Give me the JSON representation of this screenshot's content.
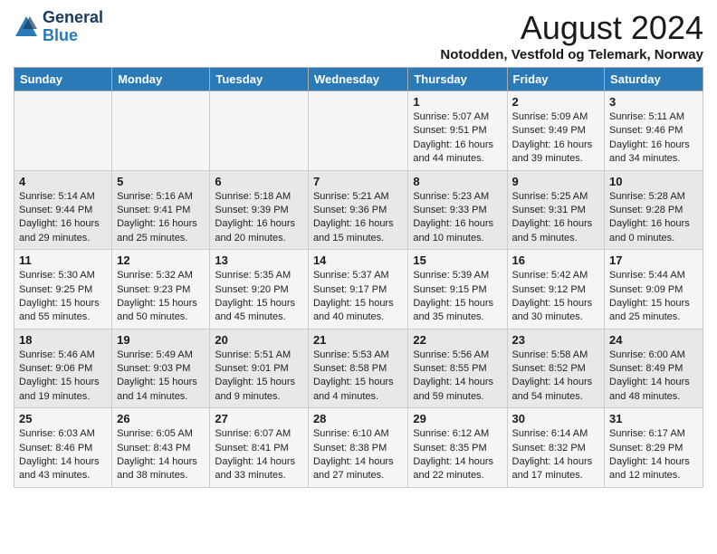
{
  "logo": {
    "general": "General",
    "blue": "Blue"
  },
  "title": "August 2024",
  "location": "Notodden, Vestfold og Telemark, Norway",
  "days_of_week": [
    "Sunday",
    "Monday",
    "Tuesday",
    "Wednesday",
    "Thursday",
    "Friday",
    "Saturday"
  ],
  "weeks": [
    [
      {
        "day": "",
        "info": ""
      },
      {
        "day": "",
        "info": ""
      },
      {
        "day": "",
        "info": ""
      },
      {
        "day": "",
        "info": ""
      },
      {
        "day": "1",
        "info": "Sunrise: 5:07 AM\nSunset: 9:51 PM\nDaylight: 16 hours and 44 minutes."
      },
      {
        "day": "2",
        "info": "Sunrise: 5:09 AM\nSunset: 9:49 PM\nDaylight: 16 hours and 39 minutes."
      },
      {
        "day": "3",
        "info": "Sunrise: 5:11 AM\nSunset: 9:46 PM\nDaylight: 16 hours and 34 minutes."
      }
    ],
    [
      {
        "day": "4",
        "info": "Sunrise: 5:14 AM\nSunset: 9:44 PM\nDaylight: 16 hours and 29 minutes."
      },
      {
        "day": "5",
        "info": "Sunrise: 5:16 AM\nSunset: 9:41 PM\nDaylight: 16 hours and 25 minutes."
      },
      {
        "day": "6",
        "info": "Sunrise: 5:18 AM\nSunset: 9:39 PM\nDaylight: 16 hours and 20 minutes."
      },
      {
        "day": "7",
        "info": "Sunrise: 5:21 AM\nSunset: 9:36 PM\nDaylight: 16 hours and 15 minutes."
      },
      {
        "day": "8",
        "info": "Sunrise: 5:23 AM\nSunset: 9:33 PM\nDaylight: 16 hours and 10 minutes."
      },
      {
        "day": "9",
        "info": "Sunrise: 5:25 AM\nSunset: 9:31 PM\nDaylight: 16 hours and 5 minutes."
      },
      {
        "day": "10",
        "info": "Sunrise: 5:28 AM\nSunset: 9:28 PM\nDaylight: 16 hours and 0 minutes."
      }
    ],
    [
      {
        "day": "11",
        "info": "Sunrise: 5:30 AM\nSunset: 9:25 PM\nDaylight: 15 hours and 55 minutes."
      },
      {
        "day": "12",
        "info": "Sunrise: 5:32 AM\nSunset: 9:23 PM\nDaylight: 15 hours and 50 minutes."
      },
      {
        "day": "13",
        "info": "Sunrise: 5:35 AM\nSunset: 9:20 PM\nDaylight: 15 hours and 45 minutes."
      },
      {
        "day": "14",
        "info": "Sunrise: 5:37 AM\nSunset: 9:17 PM\nDaylight: 15 hours and 40 minutes."
      },
      {
        "day": "15",
        "info": "Sunrise: 5:39 AM\nSunset: 9:15 PM\nDaylight: 15 hours and 35 minutes."
      },
      {
        "day": "16",
        "info": "Sunrise: 5:42 AM\nSunset: 9:12 PM\nDaylight: 15 hours and 30 minutes."
      },
      {
        "day": "17",
        "info": "Sunrise: 5:44 AM\nSunset: 9:09 PM\nDaylight: 15 hours and 25 minutes."
      }
    ],
    [
      {
        "day": "18",
        "info": "Sunrise: 5:46 AM\nSunset: 9:06 PM\nDaylight: 15 hours and 19 minutes."
      },
      {
        "day": "19",
        "info": "Sunrise: 5:49 AM\nSunset: 9:03 PM\nDaylight: 15 hours and 14 minutes."
      },
      {
        "day": "20",
        "info": "Sunrise: 5:51 AM\nSunset: 9:01 PM\nDaylight: 15 hours and 9 minutes."
      },
      {
        "day": "21",
        "info": "Sunrise: 5:53 AM\nSunset: 8:58 PM\nDaylight: 15 hours and 4 minutes."
      },
      {
        "day": "22",
        "info": "Sunrise: 5:56 AM\nSunset: 8:55 PM\nDaylight: 14 hours and 59 minutes."
      },
      {
        "day": "23",
        "info": "Sunrise: 5:58 AM\nSunset: 8:52 PM\nDaylight: 14 hours and 54 minutes."
      },
      {
        "day": "24",
        "info": "Sunrise: 6:00 AM\nSunset: 8:49 PM\nDaylight: 14 hours and 48 minutes."
      }
    ],
    [
      {
        "day": "25",
        "info": "Sunrise: 6:03 AM\nSunset: 8:46 PM\nDaylight: 14 hours and 43 minutes."
      },
      {
        "day": "26",
        "info": "Sunrise: 6:05 AM\nSunset: 8:43 PM\nDaylight: 14 hours and 38 minutes."
      },
      {
        "day": "27",
        "info": "Sunrise: 6:07 AM\nSunset: 8:41 PM\nDaylight: 14 hours and 33 minutes."
      },
      {
        "day": "28",
        "info": "Sunrise: 6:10 AM\nSunset: 8:38 PM\nDaylight: 14 hours and 27 minutes."
      },
      {
        "day": "29",
        "info": "Sunrise: 6:12 AM\nSunset: 8:35 PM\nDaylight: 14 hours and 22 minutes."
      },
      {
        "day": "30",
        "info": "Sunrise: 6:14 AM\nSunset: 8:32 PM\nDaylight: 14 hours and 17 minutes."
      },
      {
        "day": "31",
        "info": "Sunrise: 6:17 AM\nSunset: 8:29 PM\nDaylight: 14 hours and 12 minutes."
      }
    ]
  ]
}
